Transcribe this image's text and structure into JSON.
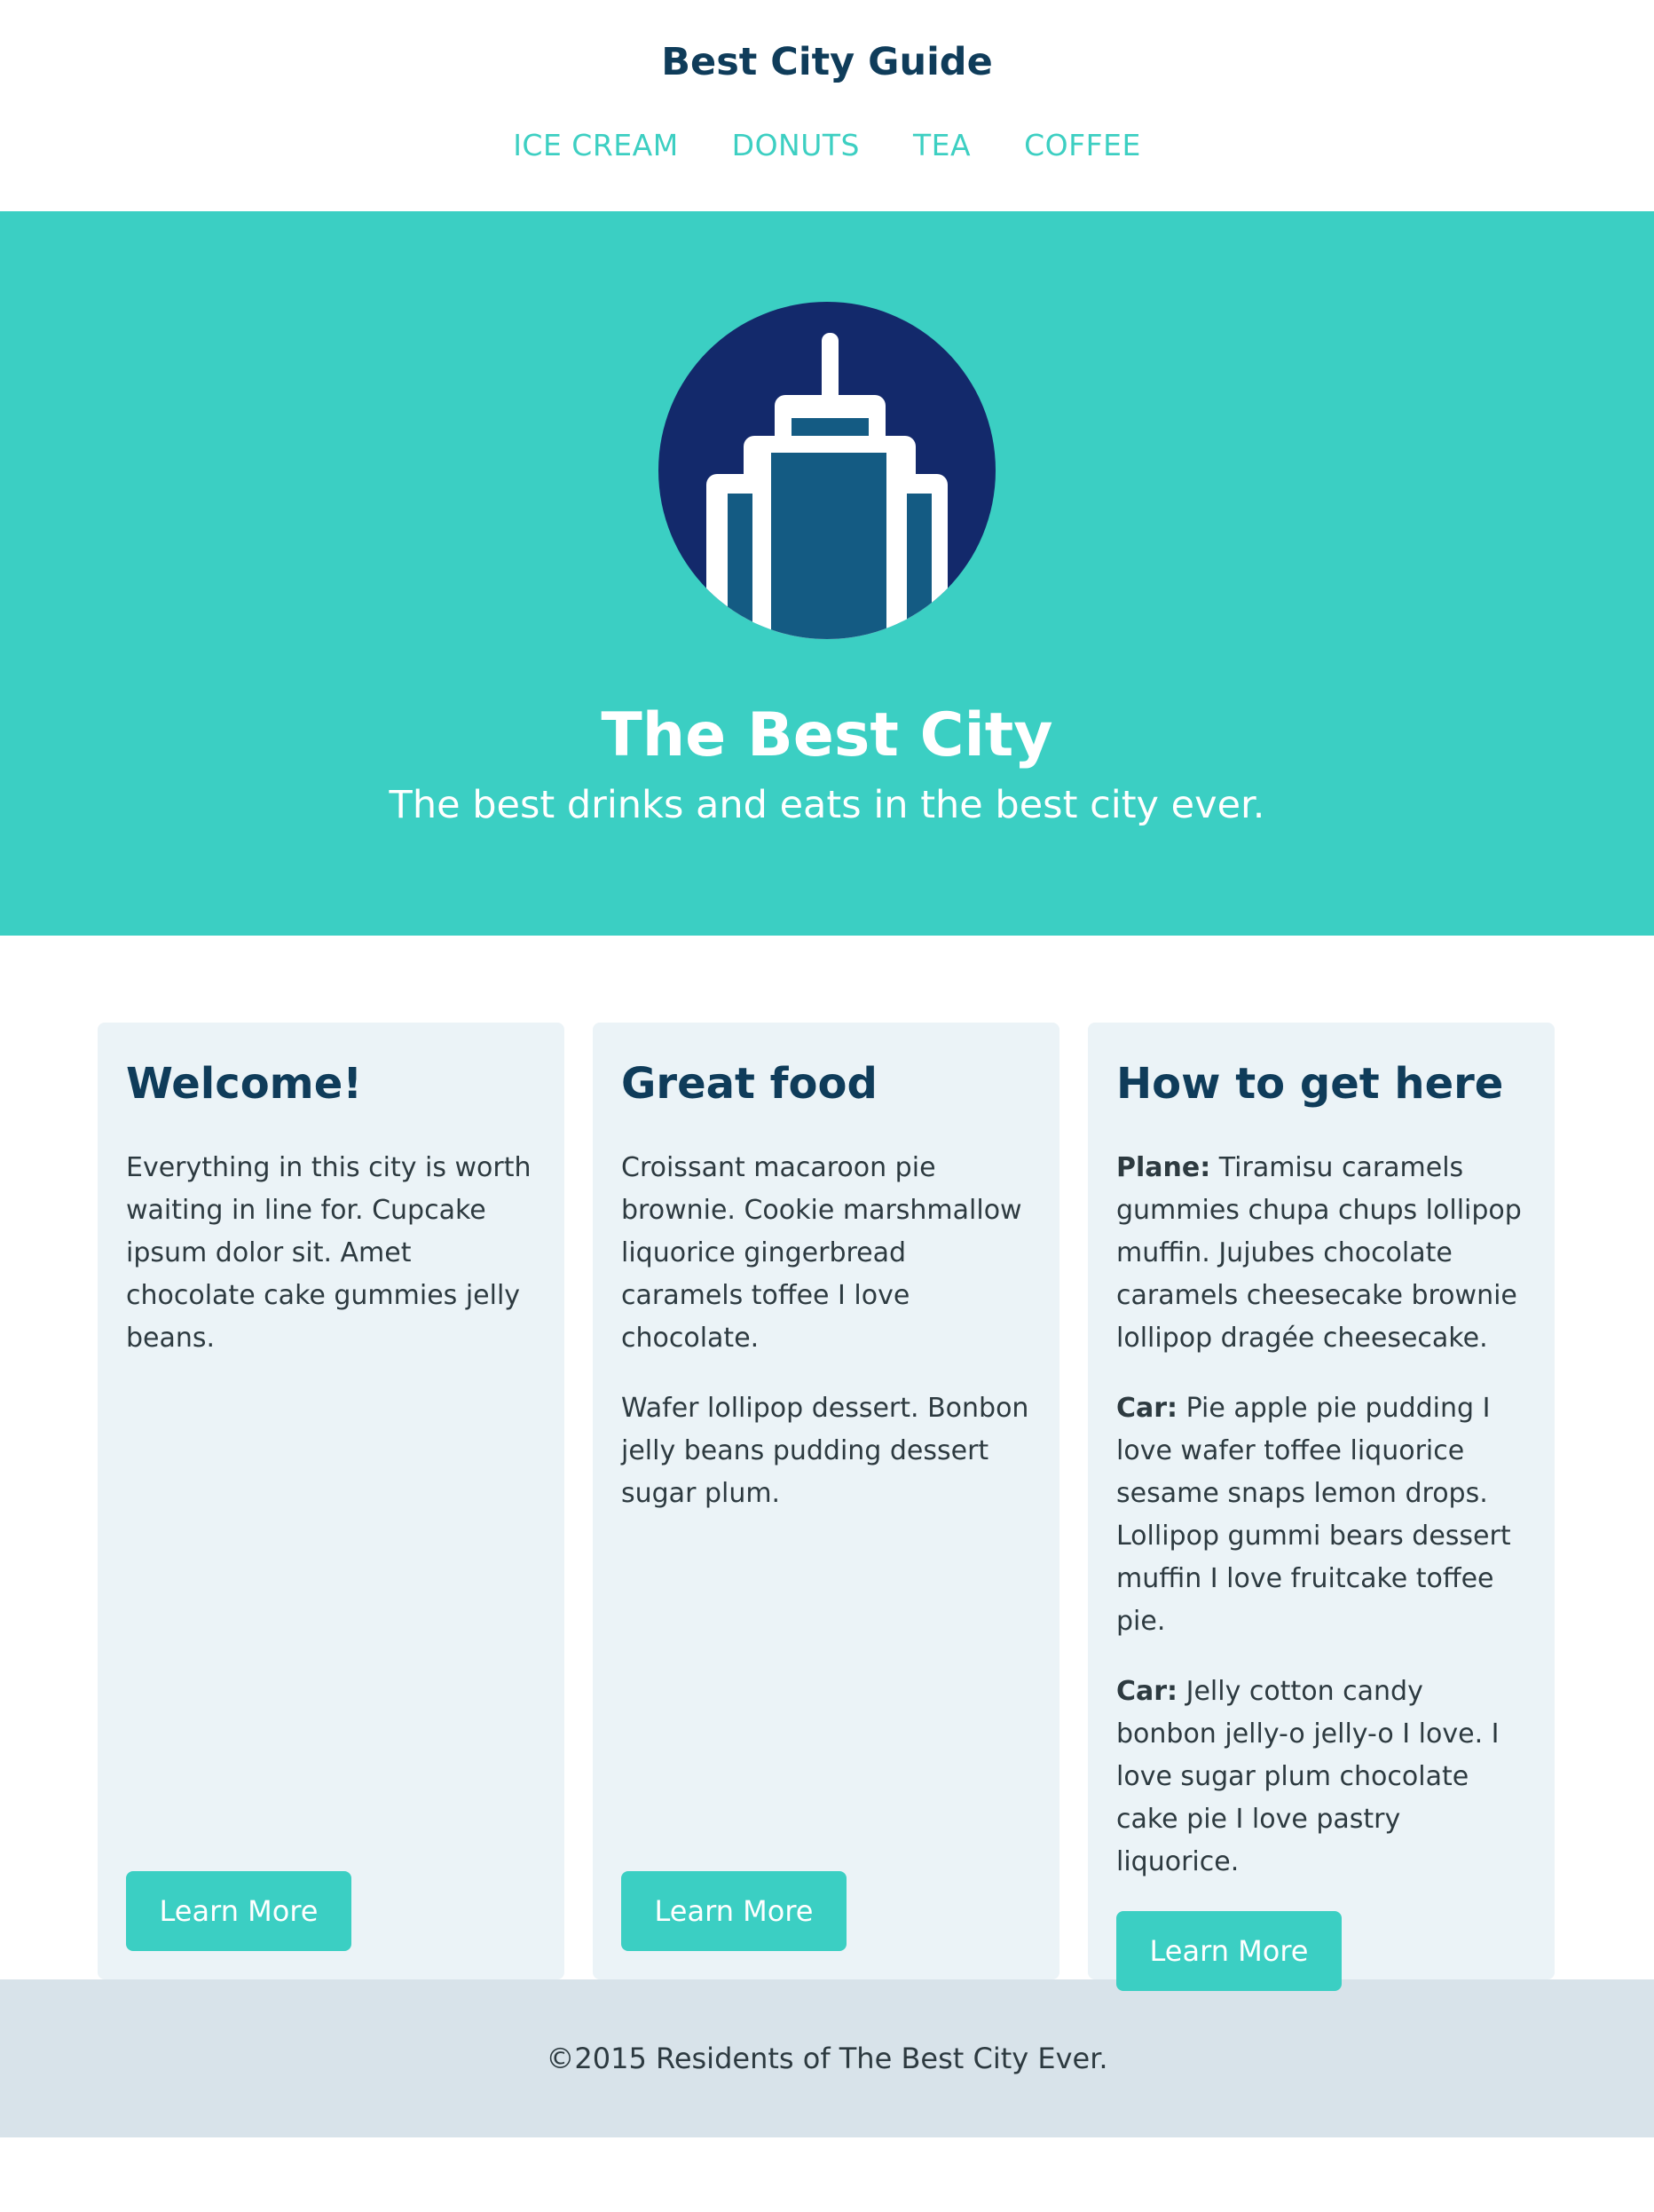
{
  "header": {
    "title": "Best City Guide",
    "nav": [
      "ICE CREAM",
      "DONUTS",
      "TEA",
      "COFFEE"
    ]
  },
  "hero": {
    "logo_icon": "city-building-icon",
    "title": "The Best City",
    "subtitle": "The best drinks and eats in the best city ever."
  },
  "cards": [
    {
      "title": "Welcome!",
      "paragraphs": [
        "Everything in this city is worth waiting in line for. Cupcake ipsum dolor sit. Amet chocolate cake gummies jelly beans."
      ],
      "button": "Learn More"
    },
    {
      "title": "Great food",
      "paragraphs": [
        "Croissant macaroon pie brownie. Cookie marshmallow liquorice gingerbread caramels toffee I love chocolate.",
        "Wafer lollipop dessert. Bonbon jelly beans pudding dessert sugar plum."
      ],
      "button": "Learn More"
    },
    {
      "title": "How to get here",
      "items": [
        {
          "label": "Plane:",
          "text": " Tiramisu caramels gummies chupa chups lollipop muffin. Jujubes chocolate caramels cheesecake brownie lollipop dragée cheesecake."
        },
        {
          "label": "Car:",
          "text": " Pie apple pie pudding I love wafer toffee liquorice sesame snaps lemon drops. Lollipop gummi bears dessert muffin I love fruitcake toffee pie."
        },
        {
          "label": "Car:",
          "text": " Jelly cotton candy bonbon jelly-o jelly-o I love. I love sugar plum chocolate cake pie I love pastry liquorice."
        }
      ],
      "button": "Learn More"
    }
  ],
  "footer": {
    "text": "©2015 Residents of The Best City Ever."
  },
  "colors": {
    "accent": "#3bcfc3",
    "title": "#0f3c5a",
    "card_bg": "#ebf3f7",
    "footer_bg": "#d8e3ea",
    "logo_circle": "#13296b",
    "logo_building": "#145b83"
  }
}
